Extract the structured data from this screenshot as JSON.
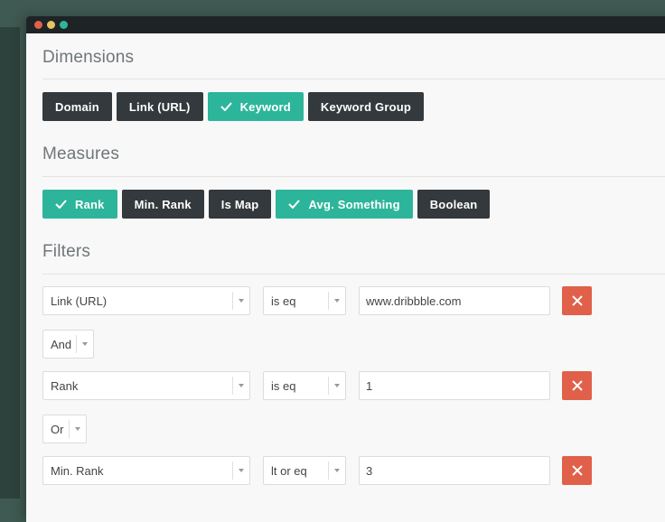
{
  "window": {
    "controls": [
      "close",
      "minimize",
      "maximize"
    ]
  },
  "dimensions": {
    "title": "Dimensions",
    "chips": [
      {
        "label": "Domain",
        "selected": false
      },
      {
        "label": "Link (URL)",
        "selected": false
      },
      {
        "label": "Keyword",
        "selected": true
      },
      {
        "label": "Keyword Group",
        "selected": false
      }
    ]
  },
  "measures": {
    "title": "Measures",
    "chips": [
      {
        "label": "Rank",
        "selected": true
      },
      {
        "label": "Min. Rank",
        "selected": false
      },
      {
        "label": "Is Map",
        "selected": false
      },
      {
        "label": "Avg. Something",
        "selected": true
      },
      {
        "label": "Boolean",
        "selected": false
      }
    ]
  },
  "filters": {
    "title": "Filters",
    "rows": [
      {
        "field": "Link (URL)",
        "operator": "is eq",
        "value": "www.dribbble.com"
      },
      {
        "field": "Rank",
        "operator": "is eq",
        "value": "1"
      },
      {
        "field": "Min. Rank",
        "operator": "lt or eq",
        "value": "3"
      }
    ],
    "connectors": [
      "And",
      "Or"
    ]
  },
  "colors": {
    "selected_chip": "#2db59b",
    "unselected_chip": "#33393c",
    "delete_button": "#e0604a",
    "background": "#3f5a52"
  },
  "icons": {
    "check": "check-icon",
    "delete": "close-icon",
    "dropdown": "chevron-down-icon"
  }
}
